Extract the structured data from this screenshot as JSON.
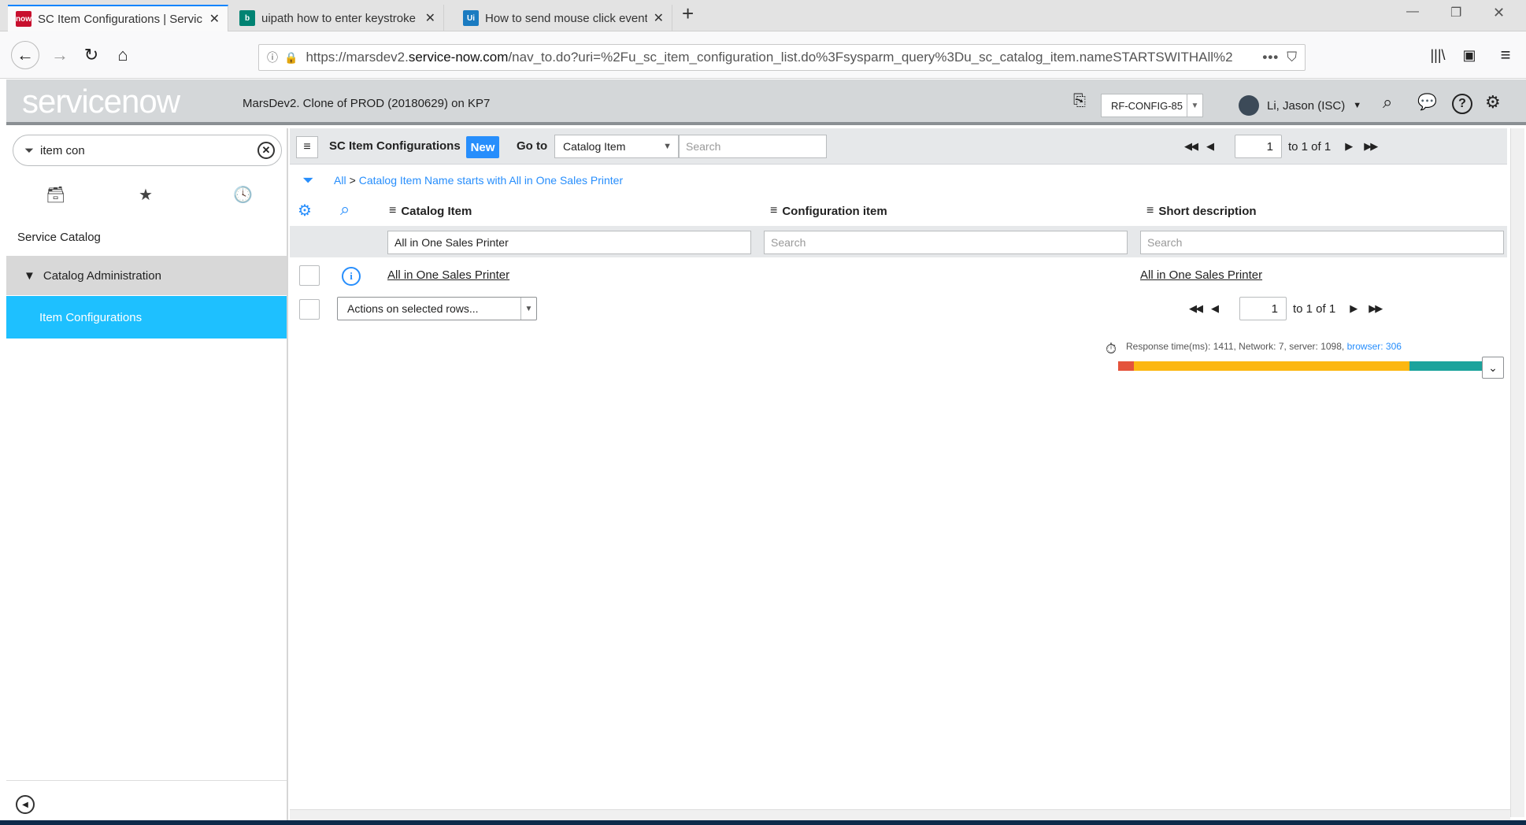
{
  "browser": {
    "tabs": [
      {
        "title": "SC Item Configurations | Servic",
        "favicon": "now",
        "favicon_color": "#c8102e"
      },
      {
        "title": "uipath how to enter keystroke -",
        "favicon": "b",
        "favicon_color": "#008373"
      },
      {
        "title": "How to send mouse click event",
        "favicon": "Ui",
        "favicon_color": "#1a7bc1"
      }
    ],
    "url_prefix": "https://marsdev2.",
    "url_host": "service-now.com",
    "url_rest": "/nav_to.do?uri=%2Fu_sc_item_configuration_list.do%3Fsysparm_query%3Du_sc_catalog_item.nameSTARTSWITHAll%2"
  },
  "header": {
    "logo": "servicenow",
    "instance": "MarsDev2. Clone of PROD (20180629) on KP7",
    "config_selector": "RF-CONFIG-85",
    "user": "Li, Jason (ISC)"
  },
  "leftnav": {
    "filter_value": "item con",
    "section": "Service Catalog",
    "module_group": "Catalog Administration",
    "module": "Item Configurations"
  },
  "list": {
    "title": "SC Item Configurations",
    "new_label": "New",
    "goto_label": "Go to",
    "goto_field": "Catalog Item",
    "search_placeholder": "Search",
    "page_current": "1",
    "page_range": "to 1 of 1",
    "breadcrumb_all": "All",
    "breadcrumb_sep": ">",
    "breadcrumb_filter": "Catalog Item Name starts with All in One Sales Printer",
    "columns": [
      "Catalog Item",
      "Configuration item",
      "Short description"
    ],
    "column_search": {
      "catalog_item": "All in One Sales Printer",
      "configuration_item": "Search",
      "short_description": "Search"
    },
    "rows": [
      {
        "catalog_item": "All in One Sales Printer",
        "configuration_item": "",
        "short_description": "All in One Sales Printer"
      }
    ],
    "actions_label": "Actions on selected rows...",
    "response_text": "Response time(ms): 1411, Network: 7, server: 1098, ",
    "response_browser": "browser: 306"
  },
  "perf": {
    "network_ms": 7,
    "server_ms": 1098,
    "browser_ms": 306,
    "colors": {
      "network": "#e4533b",
      "server": "#fcb711",
      "browser": "#1ba39c"
    }
  },
  "colors": {
    "accent": "#278efc",
    "selected_module": "#1ec0ff",
    "module_group_bg": "#d8d8d8"
  }
}
